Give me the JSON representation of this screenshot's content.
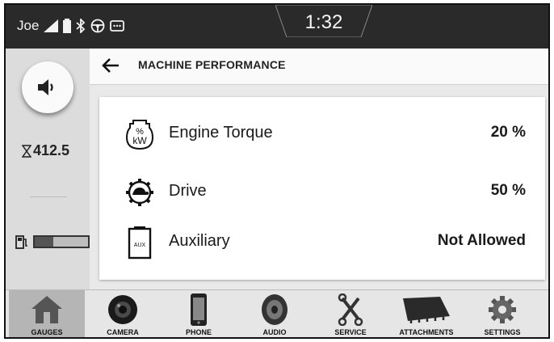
{
  "status": {
    "user": "Joe",
    "time": "1:32"
  },
  "left": {
    "hours": "412.5",
    "fuel_level": 0.35
  },
  "header": {
    "title": "MACHINE PERFORMANCE"
  },
  "rows": [
    {
      "label": "Engine Torque",
      "value": "20 %",
      "icon": "engine-torque-icon",
      "icon_text_top": "%",
      "icon_text_bottom": "kW"
    },
    {
      "label": "Drive",
      "value": "50 %",
      "icon": "drive-turtle-gear-icon"
    },
    {
      "label": "Auxiliary",
      "value": "Not Allowed",
      "icon": "auxiliary-icon",
      "icon_text": "AUX"
    }
  ],
  "nav": [
    {
      "label": "GAUGES",
      "icon": "house-icon",
      "active": true
    },
    {
      "label": "CAMERA",
      "icon": "camera-icon"
    },
    {
      "label": "PHONE",
      "icon": "phone-icon"
    },
    {
      "label": "AUDIO",
      "icon": "speaker-icon"
    },
    {
      "label": "SERVICE",
      "icon": "wrench-icon"
    },
    {
      "label": "ATTACHMENTS",
      "icon": "bucket-icon"
    },
    {
      "label": "SETTINGS",
      "icon": "gear-icon"
    }
  ]
}
